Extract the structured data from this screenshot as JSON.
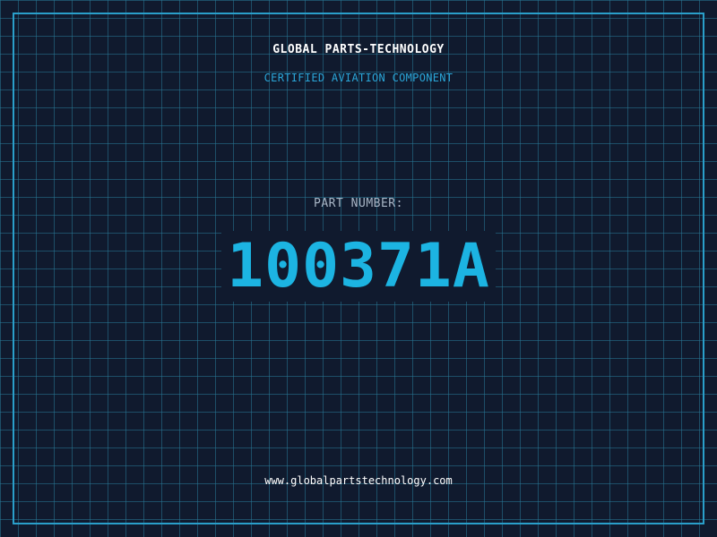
{
  "company": "GLOBAL PARTS-TECHNOLOGY",
  "tagline": "CERTIFIED AVIATION COMPONENT",
  "part": {
    "label": "PART NUMBER:",
    "number": "100371A"
  },
  "website": "www.globalpartstechnology.com",
  "colors": {
    "background": "#101a2e",
    "grid": "#28789a",
    "frame": "#2a9fca",
    "accent": "#1cb4e2",
    "tagline": "#2aa6d8",
    "label": "#a9b6c6",
    "text": "#ffffff"
  }
}
